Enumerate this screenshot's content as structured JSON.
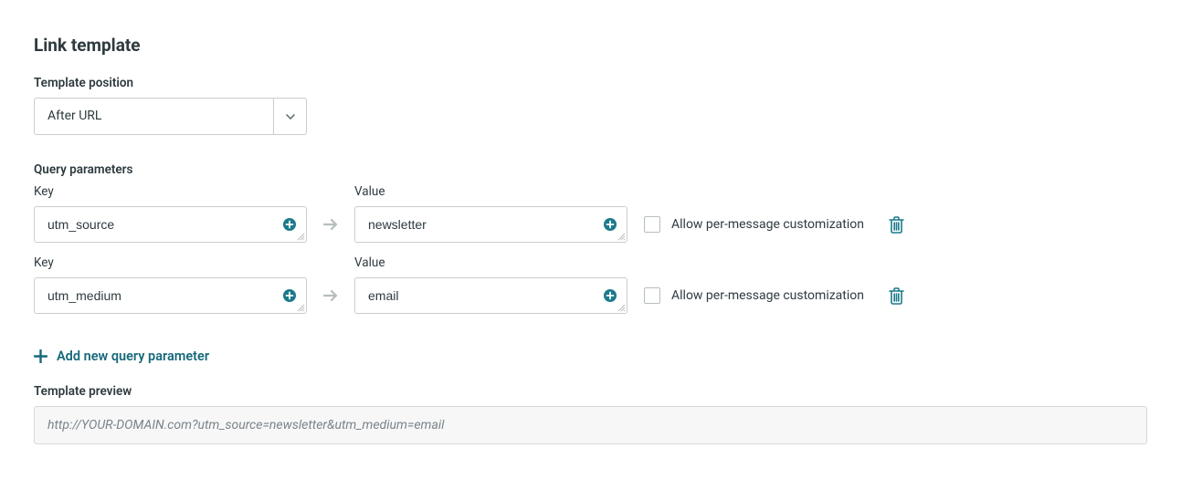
{
  "section_title": "Link template",
  "template_position": {
    "label": "Template position",
    "value": "After URL"
  },
  "query_parameters_label": "Query parameters",
  "column_key_label": "Key",
  "column_value_label": "Value",
  "rows": [
    {
      "key": "utm_source",
      "value": "newsletter",
      "customize_label": "Allow per-message customization"
    },
    {
      "key": "utm_medium",
      "value": "email",
      "customize_label": "Allow per-message customization"
    }
  ],
  "add_new_label": "Add new query parameter",
  "preview_label": "Template preview",
  "preview_value": "http://YOUR-DOMAIN.com?utm_source=newsletter&utm_medium=email"
}
